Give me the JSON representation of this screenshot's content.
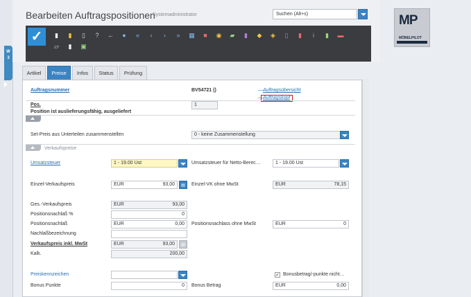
{
  "header": {
    "title": "Bearbeiten Auftragspositionen",
    "subtitle": "Systemadministrator",
    "search_value": "Suchen (Alt+s)"
  },
  "logo": {
    "text": "MP",
    "sub": "MÖBELPILOT"
  },
  "side_tab": {
    "label": "W\n3"
  },
  "toolbar": {
    "check": "✓",
    "icons": [
      "new-document-icon",
      "edit-document-icon",
      "delete-icon",
      "help-icon",
      "back-icon",
      "search-icon",
      "first-icon",
      "previous-icon",
      "next-icon",
      "last-icon",
      "list-icon",
      "group-icon",
      "link-icon",
      "report-icon",
      "export-icon",
      "tools-icon",
      "label-icon",
      "print-icon",
      "document-red-icon",
      "info-icon",
      "document-green-icon",
      "flag-icon",
      "keyboard-icon",
      "document-small-icon",
      "image-icon"
    ]
  },
  "tabs": [
    {
      "label": "Artikel"
    },
    {
      "label": "Preise"
    },
    {
      "label": "Infos"
    },
    {
      "label": "Status"
    },
    {
      "label": "Prüfung"
    }
  ],
  "form": {
    "auftragsnummer_label": "Auftragsnummer",
    "auftragsnummer_value": "BV54721 ()",
    "auftragsuebersicht_link": "Auftragsübersicht",
    "auftragskopf_link": "Auftragskopf",
    "pos_label": "Pos.",
    "pos_value": "1",
    "status_text": "Position ist auslieferungsfähig, ausgeliefert",
    "setpreis_label": "Set-Preis aus Unterteilen zusammenstellen",
    "setpreis_value": "0 - keine Zusammenstellung",
    "verkaufspreise_section": "Verkaufspreise",
    "umsatzsteuer_label": "Umsatzsteuer",
    "umsatzsteuer_value": "1 - 19.00 Ust",
    "umsatzsteuer_netto_label": "Umsatzsteuer für Netto-Berec…",
    "umsatzsteuer_netto_value": "1 - 19.00 Ust",
    "einzel_vk_label": "Einzel-Verkaufspreis",
    "einzel_vk_cur": "EUR",
    "einzel_vk_value": "93,00",
    "einzel_vk_ohne_label": "Einzel-VK ohne MwSt",
    "einzel_vk_ohne_cur": "EUR",
    "einzel_vk_ohne_value": "78,15",
    "ges_vk_label": "Ges.-Verkaufspreis",
    "ges_vk_cur": "EUR",
    "ges_vk_value": "93,00",
    "pos_nachlass_pct_label": "Positionsnachlaß %",
    "pos_nachlass_pct_value": "0",
    "pos_nachlass_label": "Positionsnachlaß",
    "pos_nachlass_cur": "EUR",
    "pos_nachlass_value": "0,00",
    "pos_nachlass_ohne_label": "Positionsnachlass ohne MwSt",
    "pos_nachlass_ohne_cur": "EUR",
    "pos_nachlass_ohne_value": "0",
    "nachlass_bez_label": "Nachlaßbezeichnung",
    "vk_inkl_label": "Verkaufspreis inkl. MwSt",
    "vk_inkl_cur": "EUR",
    "vk_inkl_value": "93,00",
    "kalk_label": "Kalk.",
    "kalk_value": "200,00",
    "preiskennzeichen_label": "Preiskennzeichen",
    "bonus_check_label": "Bonusbetrag/-punkte nicht…",
    "bonus_punkte_label": "Bonus Punkte",
    "bonus_punkte_value": "0",
    "bonus_betrag_label": "Bonus Betrag",
    "bonus_betrag_cur": "EUR",
    "bonus_betrag_value": "0,00"
  }
}
